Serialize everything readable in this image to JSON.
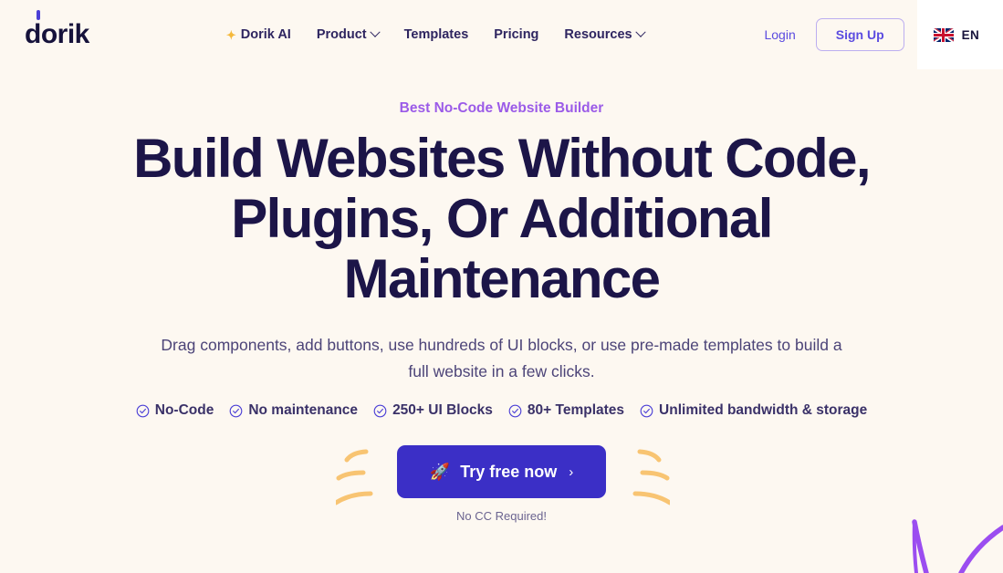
{
  "brand": {
    "logo_text": "dorik",
    "logo_accent_color": "#4B3FD6"
  },
  "nav": {
    "items": [
      {
        "label": "Dorik AI",
        "icon": "sparkles-icon",
        "has_dropdown": false
      },
      {
        "label": "Product",
        "has_dropdown": true
      },
      {
        "label": "Templates",
        "has_dropdown": false
      },
      {
        "label": "Pricing",
        "has_dropdown": false
      },
      {
        "label": "Resources",
        "has_dropdown": true
      }
    ],
    "login_label": "Login",
    "signup_label": "Sign Up",
    "language": {
      "code": "EN",
      "flag": "uk-flag-icon"
    }
  },
  "hero": {
    "eyebrow": "Best No-Code Website Builder",
    "eyebrow_color": "#9B5BE8",
    "headline_line1": "Build Websites Without Code,",
    "headline_line2": "Plugins, Or Additional",
    "headline_line3": "Maintenance",
    "headline_color": "#1C1548",
    "subheadline_line1": "Drag components, add buttons, use hundreds of UI blocks, or use pre-made templates to",
    "subheadline_line2": "build a full website in a few clicks.",
    "features": [
      "No-Code",
      "No maintenance",
      "250+ UI Blocks",
      "80+ Templates",
      "Unlimited bandwidth & storage"
    ],
    "cta_label": "Try free now",
    "cta_icon": "rocket-icon",
    "cta_arrow": "›",
    "cta_bg_color": "#3B2FC6",
    "cta_note": "No CC Required!"
  },
  "theme": {
    "page_background": "#FDF8F1",
    "accent_orange": "#F8C472",
    "accent_purple": "#9B4DF0"
  }
}
